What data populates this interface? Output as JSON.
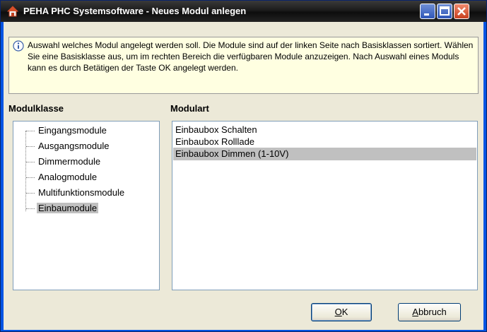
{
  "window": {
    "title": "PEHA PHC Systemsoftware - Neues Modul anlegen"
  },
  "info": {
    "text": "Auswahl welches Modul angelegt werden soll. Die Module sind auf der linken Seite nach Basisklassen sortiert. Wählen Sie eine Basisklasse aus, um im rechten Bereich die verfügbaren Module anzuzeigen. Nach Auswahl eines Moduls kann es durch Betätigen der Taste OK angelegt werden."
  },
  "modulklasse": {
    "label": "Modulklasse",
    "items": [
      "Eingangsmodule",
      "Ausgangsmodule",
      "Dimmermodule",
      "Analogmodule",
      "Multifunktionsmodule",
      "Einbaumodule"
    ],
    "selected_index": 5
  },
  "modulart": {
    "label": "Modulart",
    "items": [
      "Einbaubox Schalten",
      "Einbaubox Rolllade",
      "Einbaubox Dimmen (1-10V)"
    ],
    "selected_index": 2
  },
  "buttons": {
    "ok_mnemonic": "O",
    "ok_rest": "K",
    "cancel_mnemonic": "A",
    "cancel_rest": "bbruch"
  },
  "colors": {
    "selection": "#c0c0c0",
    "info_background": "#ffffe1",
    "dialog_background": "#ece9d8"
  }
}
